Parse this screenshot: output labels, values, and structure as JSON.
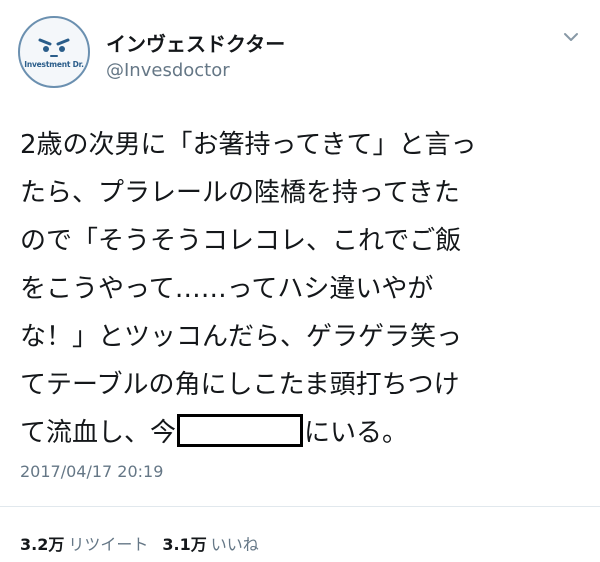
{
  "account": {
    "display_name": "インヴェスドクター",
    "handle": "@Invesdoctor",
    "avatar_text": "Investment Dr."
  },
  "tweet": {
    "lines": [
      "2歳の次男に「お箸持ってきて」と言っ",
      "たら、プラレールの陸橋を持ってきた",
      "ので「そうそうコレコレ、これでご飯",
      "をこうやって……ってハシ違いやが",
      "な！」とツッコんだら、ゲラゲラ笑っ",
      "てテーブルの角にしこたま頭打ちつけ"
    ],
    "last_line_before": "て流血し、今",
    "last_line_after": "にいる。",
    "timestamp": "2017/04/17 20:19"
  },
  "stats": {
    "retweets_count": "3.2万",
    "retweets_label": "リツイート",
    "likes_count": "3.1万",
    "likes_label": "いいね"
  },
  "colors": {
    "text": "#14171a",
    "secondary": "#657786",
    "divider": "#e1e8ed",
    "avatar_ring": "#6b90b0"
  }
}
